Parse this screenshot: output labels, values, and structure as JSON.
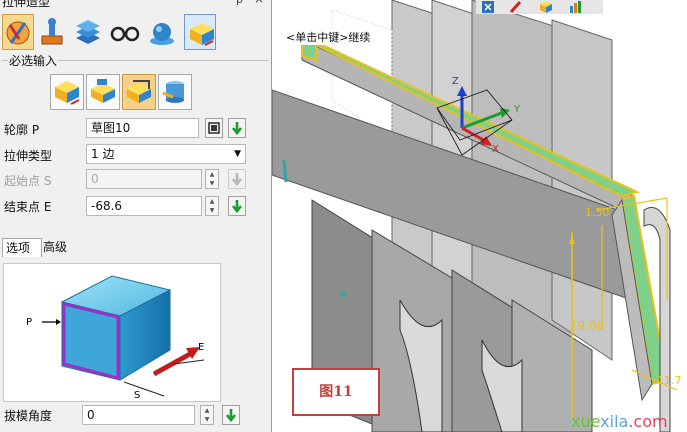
{
  "panel": {
    "title": "拉伸造型",
    "pin_glyph": "ᵽ",
    "close_glyph": "×",
    "type_buttons": [
      "drafting-icon",
      "stamp-icon",
      "layers-icon",
      "glasses-icon",
      "sphere-icon",
      "extrude-icon"
    ],
    "required_group_title": "必选输入",
    "sub_buttons": [
      "extrude-add-icon",
      "extrude-cut-icon",
      "extrude-intersect-icon",
      "extrude-solid-icon"
    ],
    "rows": {
      "profile": {
        "label": "轮廓 P",
        "value": "草图10"
      },
      "extrude_type": {
        "label": "拉伸类型",
        "value": "1 边"
      },
      "start_point": {
        "label": "起始点 S",
        "value": "0"
      },
      "end_point": {
        "label": "结束点 E",
        "value": "-68.6"
      },
      "draft_angle": {
        "label": "拔模角度",
        "value": "0"
      }
    },
    "tabs": [
      "选项",
      "高级"
    ],
    "preview_labels": {
      "p": "P",
      "e": "E",
      "s": "S"
    }
  },
  "viewport": {
    "hint": "<单击中键>继续",
    "axis_labels": {
      "z": "Z",
      "y": "Y",
      "x": "X"
    },
    "dimension_labels": [
      "1.50",
      "19.00",
      "11.7"
    ],
    "figure_label": "图11",
    "watermark": {
      "part_a": "xue",
      "part_b": "xila",
      "part_c": ".com"
    }
  },
  "colors": {
    "accent_green": "#1e9a2e",
    "highlight_face": "#7fd18a",
    "dimension_yellow": "#e8c21a",
    "figure_red": "#c4413a"
  }
}
